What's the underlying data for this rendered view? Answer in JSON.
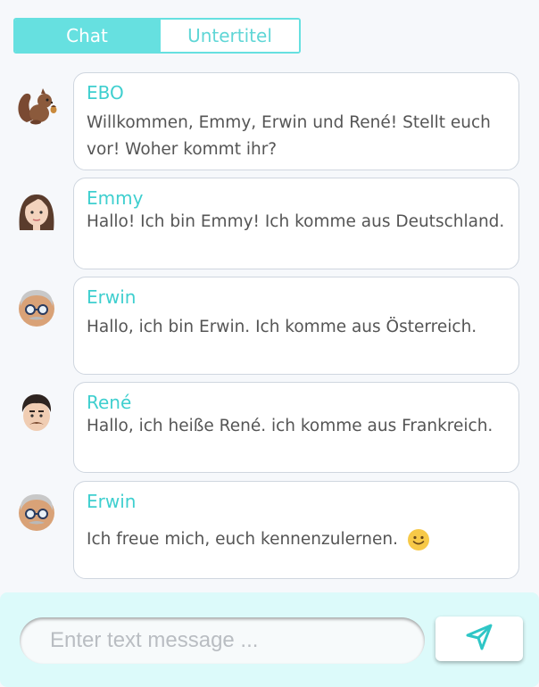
{
  "tabs": {
    "chat": "Chat",
    "subtitles": "Untertitel"
  },
  "messages": [
    {
      "sender": "EBO",
      "avatar": "squirrel-icon",
      "text": "Willkommen, Emmy, Erwin und René! Stellt euch vor! Woher kommt ihr?"
    },
    {
      "sender": "Emmy",
      "avatar": "woman-icon",
      "text": "Hallo! Ich bin Emmy! Ich komme aus Deutschland."
    },
    {
      "sender": "Erwin",
      "avatar": "old-man-icon",
      "text": "Hallo, ich bin Erwin. Ich komme aus Österreich."
    },
    {
      "sender": "René",
      "avatar": "man-mustache-icon",
      "text": "Hallo, ich heiße René. ich komme aus Frankreich."
    },
    {
      "sender": "Erwin",
      "avatar": "old-man-icon",
      "text": "Ich freue mich, euch kennenzulernen.",
      "emoji": "smiley-icon"
    }
  ],
  "composer": {
    "placeholder": "Enter text message ..."
  },
  "colors": {
    "accent": "#66e0e0",
    "name": "#3fcfcf",
    "footer": "#dcfafa"
  }
}
